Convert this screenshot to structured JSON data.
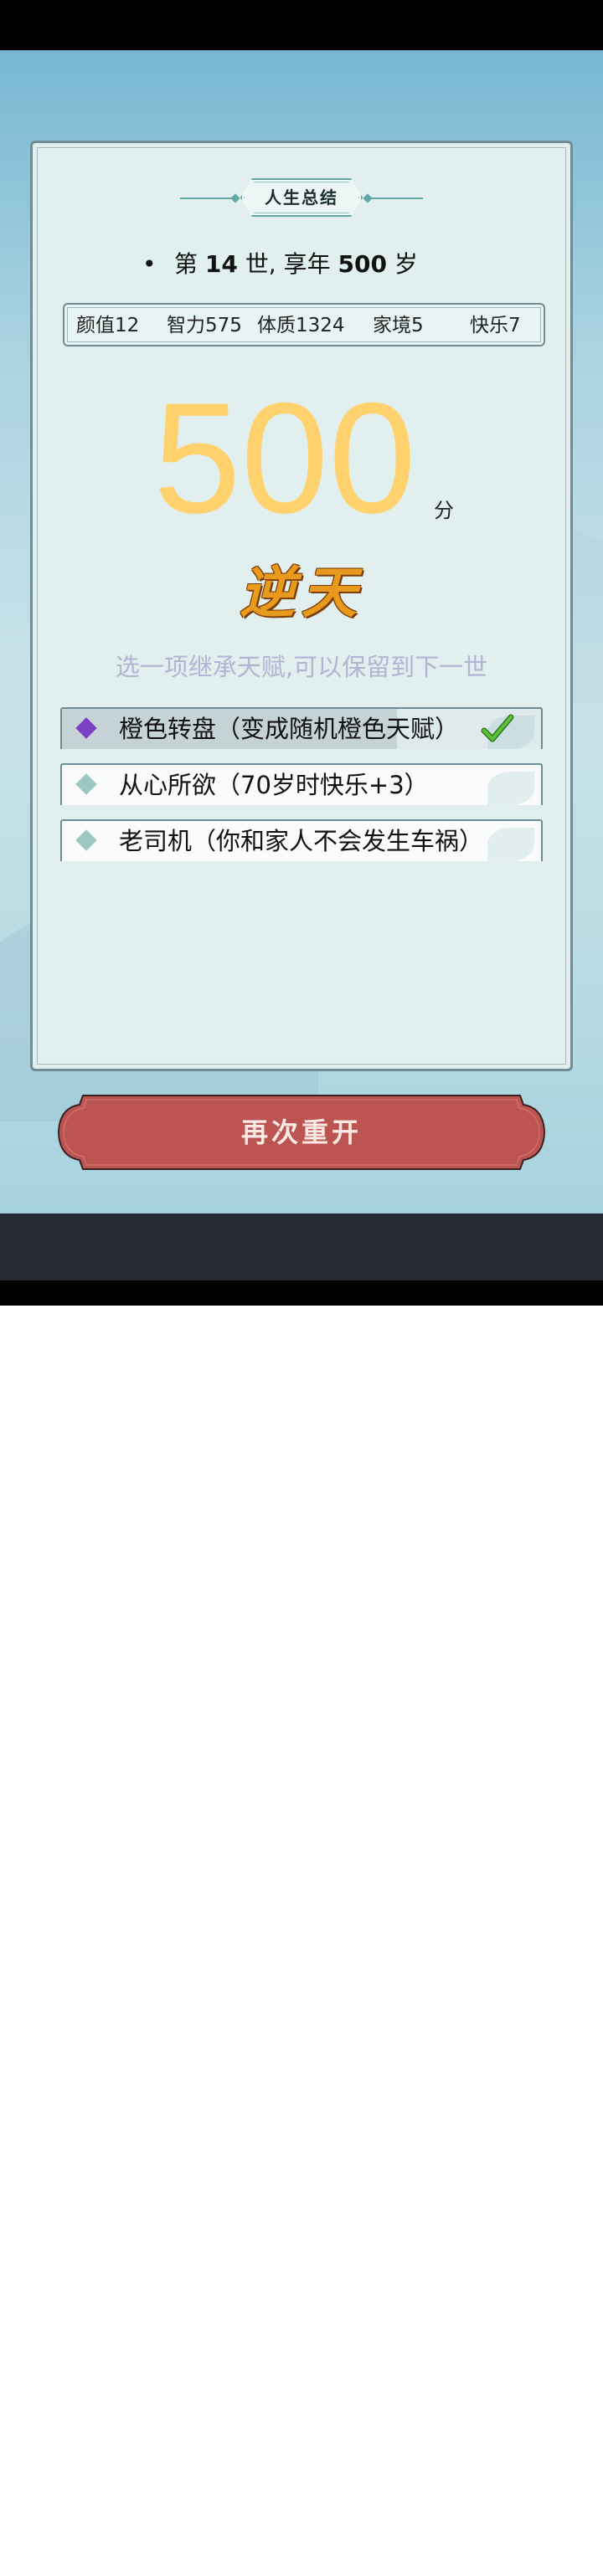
{
  "summary": {
    "title": "人生总结",
    "life_prefix": "第",
    "life_number": "14",
    "life_mid": "世, 享年",
    "age": "500",
    "age_unit": "岁"
  },
  "stats": [
    {
      "label": "颜值12"
    },
    {
      "label": "智力575"
    },
    {
      "label": "体质1324"
    },
    {
      "label": "家境5"
    },
    {
      "label": "快乐7"
    }
  ],
  "score": {
    "value": "500",
    "unit": "分",
    "rank": "逆天"
  },
  "inherit": {
    "hint": "选一项继承天赋,可以保留到下一世",
    "options": [
      {
        "label": "橙色转盘（变成随机橙色天赋）",
        "selected": true
      },
      {
        "label": "从心所欲（70岁时快乐+3）",
        "selected": false
      },
      {
        "label": "老司机（你和家人不会发生车祸）",
        "selected": false
      }
    ]
  },
  "actions": {
    "restart_label": "再次重开"
  },
  "colors": {
    "score": "#ffd26e",
    "rank": "#e89a1e",
    "restart_button": "#bc5552",
    "selected_diamond": "#7d3fc4",
    "diamond": "#9cc7c3",
    "check": "#5cc13a"
  }
}
